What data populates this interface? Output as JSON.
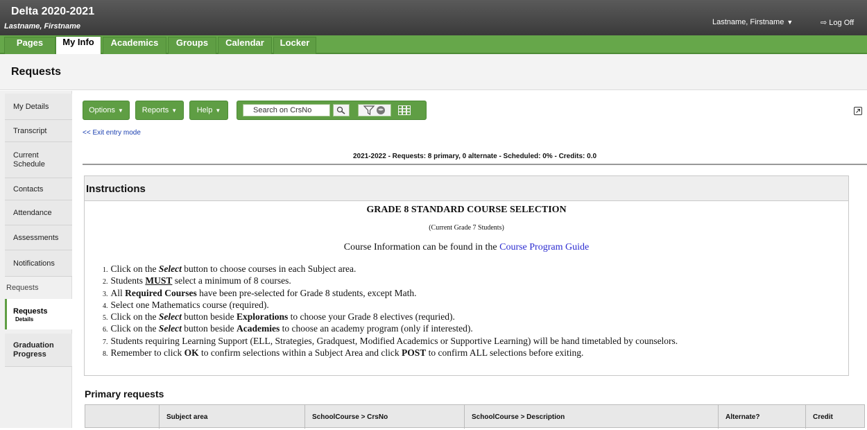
{
  "header": {
    "org_title": "Delta 2020-2021",
    "user_subtitle": "Lastname, Firstname",
    "user_menu": "Lastname, Firstname",
    "logoff": "Log Off"
  },
  "tabs": [
    "Pages",
    "My Info",
    "Academics",
    "Groups",
    "Calendar",
    "Locker"
  ],
  "active_tab": "My Info",
  "page_title": "Requests",
  "sidebar": {
    "items": [
      "My Details",
      "Transcript",
      "Current Schedule",
      "Contacts",
      "Attendance",
      "Assessments",
      "Notifications"
    ],
    "section_label": "Requests",
    "active_item": {
      "label": "Requests",
      "sub": "Details"
    },
    "after_items": [
      "Graduation Progress"
    ]
  },
  "toolbar": {
    "options": "Options",
    "reports": "Reports",
    "help": "Help",
    "search_placeholder": "Search on CrsNo"
  },
  "exit_link": "<< Exit entry mode",
  "summary": "2021-2022 - Requests: 8 primary, 0 alternate - Scheduled: 0% - Credits: 0.0",
  "instructions": {
    "title": "Instructions",
    "grade_title": "GRADE 8 STANDARD COURSE SELECTION",
    "grade_sub": "(Current Grade 7 Students)",
    "info_prefix": "Course Information can be found in the ",
    "info_link": "Course Program Guide",
    "steps": [
      {
        "n": "1.",
        "parts": [
          [
            "t",
            "Click on the "
          ],
          [
            "bi",
            "Select"
          ],
          [
            "t",
            " button to choose courses in each Subject area."
          ]
        ]
      },
      {
        "n": "2.",
        "parts": [
          [
            "t",
            "Students "
          ],
          [
            "bu",
            "MUST"
          ],
          [
            "t",
            " select a minimum of 8 courses."
          ]
        ]
      },
      {
        "n": "3.",
        "parts": [
          [
            "t",
            "All "
          ],
          [
            "b",
            "Required Courses"
          ],
          [
            "t",
            " have been pre-selected for Grade 8 students, except Math."
          ]
        ]
      },
      {
        "n": "4.",
        "parts": [
          [
            "t",
            "Select one Mathematics course (required)."
          ]
        ]
      },
      {
        "n": "5.",
        "parts": [
          [
            "t",
            "Click on the "
          ],
          [
            "bi",
            "Select"
          ],
          [
            "t",
            " button beside "
          ],
          [
            "b",
            "Explorations"
          ],
          [
            "t",
            " to choose your Grade 8 electives (requried)."
          ]
        ]
      },
      {
        "n": "6.",
        "parts": [
          [
            "t",
            "Click on the "
          ],
          [
            "bi",
            "Select"
          ],
          [
            "t",
            " button beside "
          ],
          [
            "b",
            "Academies"
          ],
          [
            "t",
            " to choose an academy program (only if interested)."
          ]
        ]
      },
      {
        "n": "7.",
        "parts": [
          [
            "t",
            "Students requiring Learning Support (ELL, Strategies, Gradquest, Modified Academics or Supportive Learning) will be hand timetabled by counselors."
          ]
        ]
      },
      {
        "n": "8.",
        "parts": [
          [
            "t",
            "Remember to click "
          ],
          [
            "b",
            "OK"
          ],
          [
            "t",
            " to confirm selections within a Subject Area and click "
          ],
          [
            "b",
            "POST"
          ],
          [
            "t",
            " to confirm ALL selections before exiting."
          ]
        ]
      }
    ]
  },
  "primary": {
    "title": "Primary requests",
    "columns": [
      "",
      "Subject area",
      "SchoolCourse > CrsNo",
      "SchoolCourse > Description",
      "Alternate?",
      "Credit"
    ]
  },
  "colors": {
    "green": "#5f9e44",
    "header": "#444444",
    "link": "#1a3fb0"
  }
}
